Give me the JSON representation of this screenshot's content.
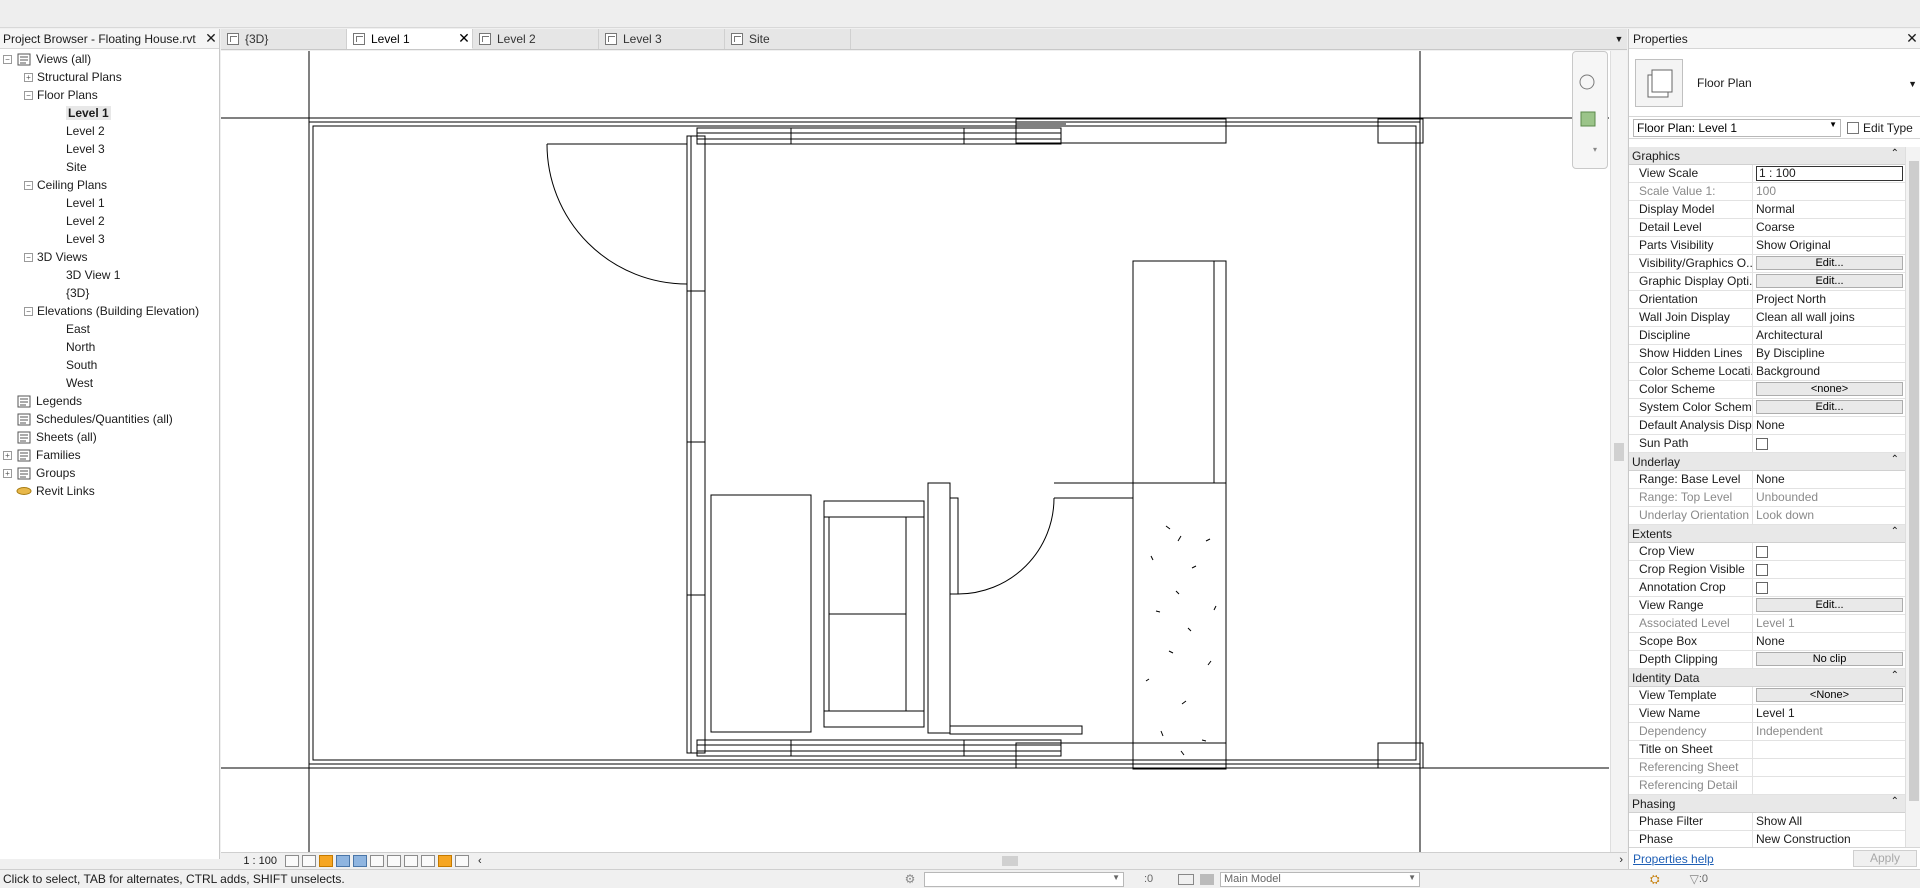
{
  "browser": {
    "title": "Project Browser - Floating House.rvt",
    "nodes": [
      {
        "label": "Views (all)",
        "level": 0,
        "exp": "−",
        "icon": "views-icon"
      },
      {
        "label": "Structural Plans",
        "level": 1,
        "exp": "+"
      },
      {
        "label": "Floor Plans",
        "level": 1,
        "exp": "−"
      },
      {
        "label": "Level 1",
        "level": 2,
        "selected": true
      },
      {
        "label": "Level 2",
        "level": 2
      },
      {
        "label": "Level 3",
        "level": 2
      },
      {
        "label": "Site",
        "level": 2
      },
      {
        "label": "Ceiling Plans",
        "level": 1,
        "exp": "−"
      },
      {
        "label": "Level 1",
        "level": 2
      },
      {
        "label": "Level 2",
        "level": 2
      },
      {
        "label": "Level 3",
        "level": 2
      },
      {
        "label": "3D Views",
        "level": 1,
        "exp": "−"
      },
      {
        "label": "3D View 1",
        "level": 2
      },
      {
        "label": "{3D}",
        "level": 2
      },
      {
        "label": "Elevations (Building Elevation)",
        "level": 1,
        "exp": "−"
      },
      {
        "label": "East",
        "level": 2
      },
      {
        "label": "North",
        "level": 2
      },
      {
        "label": "South",
        "level": 2
      },
      {
        "label": "West",
        "level": 2
      },
      {
        "label": "Legends",
        "level": 0,
        "icon": "legends-icon"
      },
      {
        "label": "Schedules/Quantities (all)",
        "level": 0,
        "icon": "schedules-icon"
      },
      {
        "label": "Sheets (all)",
        "level": 0,
        "icon": "sheets-icon"
      },
      {
        "label": "Families",
        "level": 0,
        "exp": "+",
        "icon": "families-icon"
      },
      {
        "label": "Groups",
        "level": 0,
        "exp": "+",
        "icon": "groups-icon"
      },
      {
        "label": "Revit Links",
        "level": 0,
        "icon": "revit-links-icon"
      }
    ]
  },
  "tabs": [
    {
      "label": "{3D}",
      "active": false
    },
    {
      "label": "Level 1",
      "active": true
    },
    {
      "label": "Level 2",
      "active": false
    },
    {
      "label": "Level 3",
      "active": false
    },
    {
      "label": "Site",
      "active": false
    }
  ],
  "view_bar": {
    "scale": "1 : 100"
  },
  "status": {
    "message": "Click to select, TAB for alternates, CTRL adds, SHIFT unselects.",
    "coord": ":0",
    "model": "Main Model",
    "filter_count": ":0"
  },
  "properties": {
    "title": "Properties",
    "type_name": "Floor Plan",
    "instance_selector": "Floor Plan: Level 1",
    "edit_type": "Edit Type",
    "help_link": "Properties help",
    "apply": "Apply",
    "groups": [
      {
        "name": "Graphics",
        "rows": [
          {
            "n": "View Scale",
            "v": "1 : 100",
            "kind": "input"
          },
          {
            "n": "Scale Value    1:",
            "v": "100",
            "dim": true
          },
          {
            "n": "Display Model",
            "v": "Normal"
          },
          {
            "n": "Detail Level",
            "v": "Coarse"
          },
          {
            "n": "Parts Visibility",
            "v": "Show Original"
          },
          {
            "n": "Visibility/Graphics O...",
            "v": "Edit...",
            "kind": "button"
          },
          {
            "n": "Graphic Display Opti...",
            "v": "Edit...",
            "kind": "button"
          },
          {
            "n": "Orientation",
            "v": "Project North"
          },
          {
            "n": "Wall Join Display",
            "v": "Clean all wall joins"
          },
          {
            "n": "Discipline",
            "v": "Architectural"
          },
          {
            "n": "Show Hidden Lines",
            "v": "By Discipline"
          },
          {
            "n": "Color Scheme Locati...",
            "v": "Background"
          },
          {
            "n": "Color Scheme",
            "v": "<none>",
            "kind": "button"
          },
          {
            "n": "System Color Schemes",
            "v": "Edit...",
            "kind": "button"
          },
          {
            "n": "Default Analysis Disp...",
            "v": "None"
          },
          {
            "n": "Sun Path",
            "v": "",
            "kind": "check"
          }
        ]
      },
      {
        "name": "Underlay",
        "rows": [
          {
            "n": "Range: Base Level",
            "v": "None"
          },
          {
            "n": "Range: Top Level",
            "v": "Unbounded",
            "dim": true
          },
          {
            "n": "Underlay Orientation",
            "v": "Look down",
            "dim": true
          }
        ]
      },
      {
        "name": "Extents",
        "rows": [
          {
            "n": "Crop View",
            "v": "",
            "kind": "check"
          },
          {
            "n": "Crop Region Visible",
            "v": "",
            "kind": "check"
          },
          {
            "n": "Annotation Crop",
            "v": "",
            "kind": "check"
          },
          {
            "n": "View Range",
            "v": "Edit...",
            "kind": "button"
          },
          {
            "n": "Associated Level",
            "v": "Level 1",
            "dim": true
          },
          {
            "n": "Scope Box",
            "v": "None"
          },
          {
            "n": "Depth Clipping",
            "v": "No clip",
            "kind": "button"
          }
        ]
      },
      {
        "name": "Identity Data",
        "rows": [
          {
            "n": "View Template",
            "v": "<None>",
            "kind": "button"
          },
          {
            "n": "View Name",
            "v": "Level 1"
          },
          {
            "n": "Dependency",
            "v": "Independent",
            "dim": true
          },
          {
            "n": "Title on Sheet",
            "v": ""
          },
          {
            "n": "Referencing Sheet",
            "v": "",
            "dim": true
          },
          {
            "n": "Referencing Detail",
            "v": "",
            "dim": true
          }
        ]
      },
      {
        "name": "Phasing",
        "rows": [
          {
            "n": "Phase Filter",
            "v": "Show All"
          },
          {
            "n": "Phase",
            "v": "New Construction"
          }
        ]
      }
    ]
  }
}
